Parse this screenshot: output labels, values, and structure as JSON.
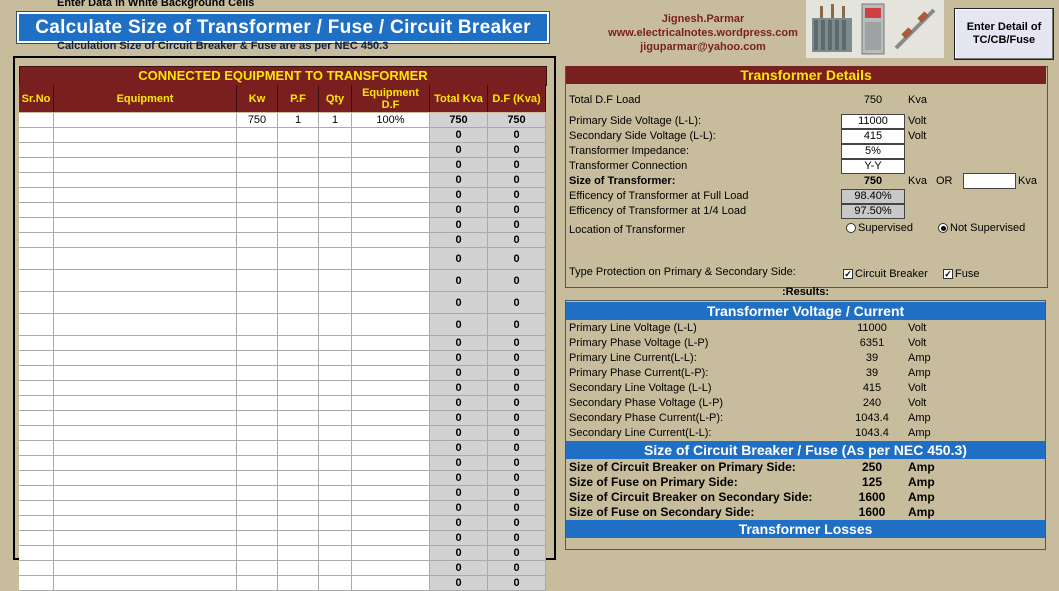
{
  "header": {
    "hint": "Enter Data in White Background Cells",
    "title": "Calculate Size of Transformer / Fuse / Circuit Breaker",
    "subtitle": "Calculation Size of Circuit Breaker & Fuse are as per NEC 450.3",
    "author_name": "Jignesh.Parmar",
    "author_site": "www.electricalnotes.wordpress.com",
    "author_email": "jiguparmar@yahoo.com",
    "button_label": "Enter Detail of TC/CB/Fuse"
  },
  "equipment": {
    "heading": "CONNECTED EQUIPMENT TO TRANSFORMER",
    "columns": [
      "Sr.No",
      "Equipment",
      "Kw",
      "P.F",
      "Qty",
      "Equipment D.F",
      "Total Kva",
      "D.F (Kva)"
    ],
    "first_row": {
      "srno": "",
      "equipment": "",
      "kw": "750",
      "pf": "1",
      "qty": "1",
      "df": "100%",
      "total_kva": "750",
      "df_kva": "750"
    },
    "zero": "0"
  },
  "details": {
    "heading": "Transformer Details",
    "total_df_load_label": "Total D.F Load",
    "total_df_load_value": "750",
    "total_df_load_unit": "Kva",
    "primary_voltage_label": "Primary Side Voltage (L-L):",
    "primary_voltage_value": "11000",
    "primary_voltage_unit": "Volt",
    "secondary_voltage_label": "Secondary  Side Voltage (L-L):",
    "secondary_voltage_value": "415",
    "secondary_voltage_unit": "Volt",
    "impedance_label": "Transformer Impedance:",
    "impedance_value": "5%",
    "connection_label": "Transformer Connection",
    "connection_value": "Y-Y",
    "size_label": "Size of Transformer:",
    "size_value": "750",
    "size_unit": "Kva",
    "or_label": "OR",
    "size_override_value": "",
    "size_override_unit": "Kva",
    "eff_full_label": "Efficency of Transformer at Full Load",
    "eff_full_value": "98.40%",
    "eff_quarter_label": "Efficency of Transformer at 1/4 Load",
    "eff_quarter_value": "97.50%",
    "location_label": "Location of Transformer",
    "location_opt1": "Supervised",
    "location_opt2": "Not Supervised",
    "protection_label": "Type Protection on Primary & Secondary Side:",
    "protection_opt1": "Circuit Breaker",
    "protection_opt2": "Fuse"
  },
  "results": {
    "label": ":Results:",
    "vc_heading": "Transformer Voltage / Current",
    "vc_rows": [
      {
        "label": "Primary Line Voltage (L-L)",
        "value": "11000",
        "unit": "Volt"
      },
      {
        "label": "Primary Phase Voltage (L-P)",
        "value": "6351",
        "unit": "Volt"
      },
      {
        "label": "Primary Line Current(L-L):",
        "value": "39",
        "unit": "Amp"
      },
      {
        "label": "Primary Phase Current(L-P):",
        "value": "39",
        "unit": "Amp"
      },
      {
        "label": "Secondary Line Voltage (L-L)",
        "value": "415",
        "unit": "Volt"
      },
      {
        "label": "Secondary Phase Voltage (L-P)",
        "value": "240",
        "unit": "Volt"
      },
      {
        "label": "Secondary Phase Current(L-P):",
        "value": "1043.4",
        "unit": "Amp"
      },
      {
        "label": "Secondary Line Current(L-L):",
        "value": "1043.4",
        "unit": "Amp"
      }
    ],
    "cb_heading": "Size of Circuit Breaker / Fuse (As per NEC 450.3)",
    "cb_rows": [
      {
        "label": "Size of Circuit Breaker on Primary Side:",
        "value": "250",
        "unit": "Amp"
      },
      {
        "label": "Size of Fuse on Primary Side:",
        "value": "125",
        "unit": "Amp"
      },
      {
        "label": "Size of Circuit Breaker on Secondary Side:",
        "value": "1600",
        "unit": "Amp"
      },
      {
        "label": "Size of Fuse on Secondary Side:",
        "value": "1600",
        "unit": "Amp"
      }
    ],
    "loss_heading": "Transformer Losses"
  }
}
